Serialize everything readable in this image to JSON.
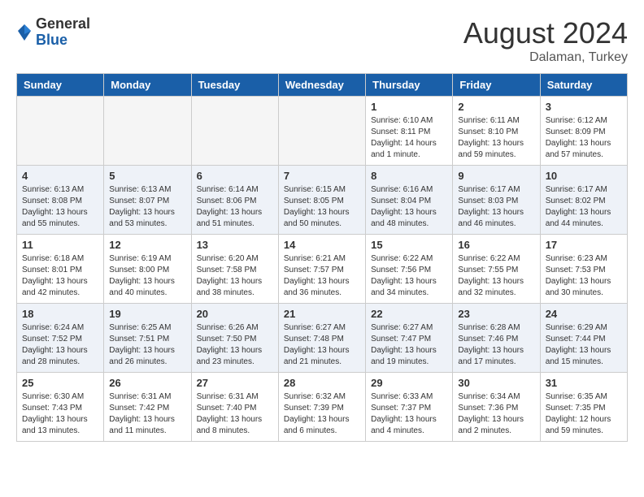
{
  "header": {
    "logo_general": "General",
    "logo_blue": "Blue",
    "month_year": "August 2024",
    "location": "Dalaman, Turkey"
  },
  "weekdays": [
    "Sunday",
    "Monday",
    "Tuesday",
    "Wednesday",
    "Thursday",
    "Friday",
    "Saturday"
  ],
  "weeks": [
    [
      {
        "day": "",
        "info": ""
      },
      {
        "day": "",
        "info": ""
      },
      {
        "day": "",
        "info": ""
      },
      {
        "day": "",
        "info": ""
      },
      {
        "day": "1",
        "info": "Sunrise: 6:10 AM\nSunset: 8:11 PM\nDaylight: 14 hours\nand 1 minute."
      },
      {
        "day": "2",
        "info": "Sunrise: 6:11 AM\nSunset: 8:10 PM\nDaylight: 13 hours\nand 59 minutes."
      },
      {
        "day": "3",
        "info": "Sunrise: 6:12 AM\nSunset: 8:09 PM\nDaylight: 13 hours\nand 57 minutes."
      }
    ],
    [
      {
        "day": "4",
        "info": "Sunrise: 6:13 AM\nSunset: 8:08 PM\nDaylight: 13 hours\nand 55 minutes."
      },
      {
        "day": "5",
        "info": "Sunrise: 6:13 AM\nSunset: 8:07 PM\nDaylight: 13 hours\nand 53 minutes."
      },
      {
        "day": "6",
        "info": "Sunrise: 6:14 AM\nSunset: 8:06 PM\nDaylight: 13 hours\nand 51 minutes."
      },
      {
        "day": "7",
        "info": "Sunrise: 6:15 AM\nSunset: 8:05 PM\nDaylight: 13 hours\nand 50 minutes."
      },
      {
        "day": "8",
        "info": "Sunrise: 6:16 AM\nSunset: 8:04 PM\nDaylight: 13 hours\nand 48 minutes."
      },
      {
        "day": "9",
        "info": "Sunrise: 6:17 AM\nSunset: 8:03 PM\nDaylight: 13 hours\nand 46 minutes."
      },
      {
        "day": "10",
        "info": "Sunrise: 6:17 AM\nSunset: 8:02 PM\nDaylight: 13 hours\nand 44 minutes."
      }
    ],
    [
      {
        "day": "11",
        "info": "Sunrise: 6:18 AM\nSunset: 8:01 PM\nDaylight: 13 hours\nand 42 minutes."
      },
      {
        "day": "12",
        "info": "Sunrise: 6:19 AM\nSunset: 8:00 PM\nDaylight: 13 hours\nand 40 minutes."
      },
      {
        "day": "13",
        "info": "Sunrise: 6:20 AM\nSunset: 7:58 PM\nDaylight: 13 hours\nand 38 minutes."
      },
      {
        "day": "14",
        "info": "Sunrise: 6:21 AM\nSunset: 7:57 PM\nDaylight: 13 hours\nand 36 minutes."
      },
      {
        "day": "15",
        "info": "Sunrise: 6:22 AM\nSunset: 7:56 PM\nDaylight: 13 hours\nand 34 minutes."
      },
      {
        "day": "16",
        "info": "Sunrise: 6:22 AM\nSunset: 7:55 PM\nDaylight: 13 hours\nand 32 minutes."
      },
      {
        "day": "17",
        "info": "Sunrise: 6:23 AM\nSunset: 7:53 PM\nDaylight: 13 hours\nand 30 minutes."
      }
    ],
    [
      {
        "day": "18",
        "info": "Sunrise: 6:24 AM\nSunset: 7:52 PM\nDaylight: 13 hours\nand 28 minutes."
      },
      {
        "day": "19",
        "info": "Sunrise: 6:25 AM\nSunset: 7:51 PM\nDaylight: 13 hours\nand 26 minutes."
      },
      {
        "day": "20",
        "info": "Sunrise: 6:26 AM\nSunset: 7:50 PM\nDaylight: 13 hours\nand 23 minutes."
      },
      {
        "day": "21",
        "info": "Sunrise: 6:27 AM\nSunset: 7:48 PM\nDaylight: 13 hours\nand 21 minutes."
      },
      {
        "day": "22",
        "info": "Sunrise: 6:27 AM\nSunset: 7:47 PM\nDaylight: 13 hours\nand 19 minutes."
      },
      {
        "day": "23",
        "info": "Sunrise: 6:28 AM\nSunset: 7:46 PM\nDaylight: 13 hours\nand 17 minutes."
      },
      {
        "day": "24",
        "info": "Sunrise: 6:29 AM\nSunset: 7:44 PM\nDaylight: 13 hours\nand 15 minutes."
      }
    ],
    [
      {
        "day": "25",
        "info": "Sunrise: 6:30 AM\nSunset: 7:43 PM\nDaylight: 13 hours\nand 13 minutes."
      },
      {
        "day": "26",
        "info": "Sunrise: 6:31 AM\nSunset: 7:42 PM\nDaylight: 13 hours\nand 11 minutes."
      },
      {
        "day": "27",
        "info": "Sunrise: 6:31 AM\nSunset: 7:40 PM\nDaylight: 13 hours\nand 8 minutes."
      },
      {
        "day": "28",
        "info": "Sunrise: 6:32 AM\nSunset: 7:39 PM\nDaylight: 13 hours\nand 6 minutes."
      },
      {
        "day": "29",
        "info": "Sunrise: 6:33 AM\nSunset: 7:37 PM\nDaylight: 13 hours\nand 4 minutes."
      },
      {
        "day": "30",
        "info": "Sunrise: 6:34 AM\nSunset: 7:36 PM\nDaylight: 13 hours\nand 2 minutes."
      },
      {
        "day": "31",
        "info": "Sunrise: 6:35 AM\nSunset: 7:35 PM\nDaylight: 12 hours\nand 59 minutes."
      }
    ]
  ]
}
